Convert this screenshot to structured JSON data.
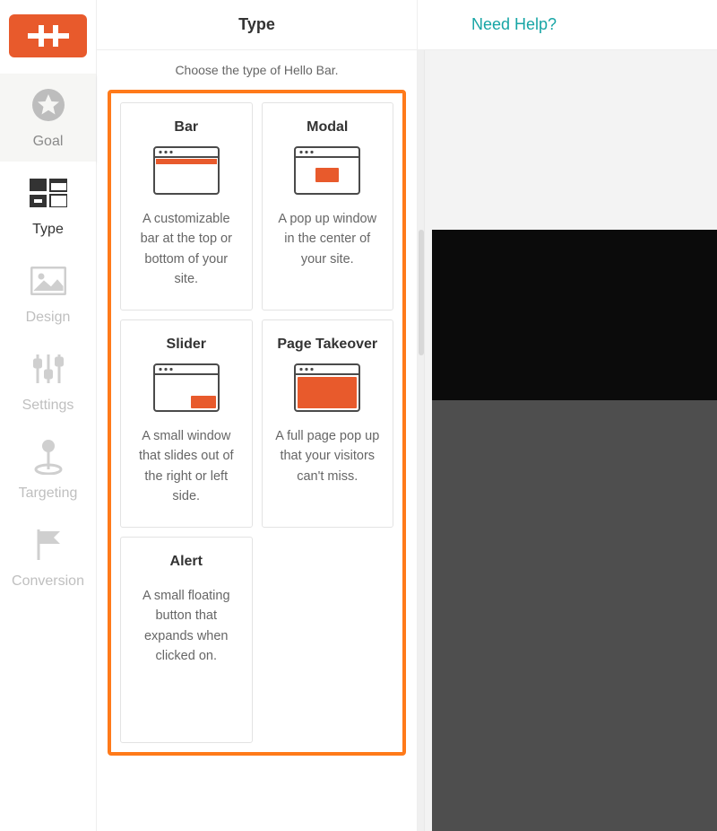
{
  "colors": {
    "brand": "#e85a2c",
    "highlight": "#ff7a1a",
    "link": "#17a5a5"
  },
  "header": {
    "help_label": "Need Help?"
  },
  "nav": {
    "items": [
      {
        "id": "goal",
        "label": "Goal"
      },
      {
        "id": "type",
        "label": "Type"
      },
      {
        "id": "design",
        "label": "Design"
      },
      {
        "id": "settings",
        "label": "Settings"
      },
      {
        "id": "targeting",
        "label": "Targeting"
      },
      {
        "id": "conversion",
        "label": "Conversion"
      }
    ],
    "active": "type"
  },
  "panel": {
    "title": "Type",
    "subtitle": "Choose the type of Hello Bar.",
    "cards": [
      {
        "id": "bar",
        "title": "Bar",
        "desc": "A customizable bar at the top or bottom of your site."
      },
      {
        "id": "modal",
        "title": "Modal",
        "desc": "A pop up window in the center of your site."
      },
      {
        "id": "slider",
        "title": "Slider",
        "desc": "A small window that slides out of the right or left side."
      },
      {
        "id": "takeover",
        "title": "Page Takeover",
        "desc": "A full page pop up that your visitors can't miss."
      },
      {
        "id": "alert",
        "title": "Alert",
        "desc": "A small floating button that expands when clicked on."
      }
    ]
  }
}
